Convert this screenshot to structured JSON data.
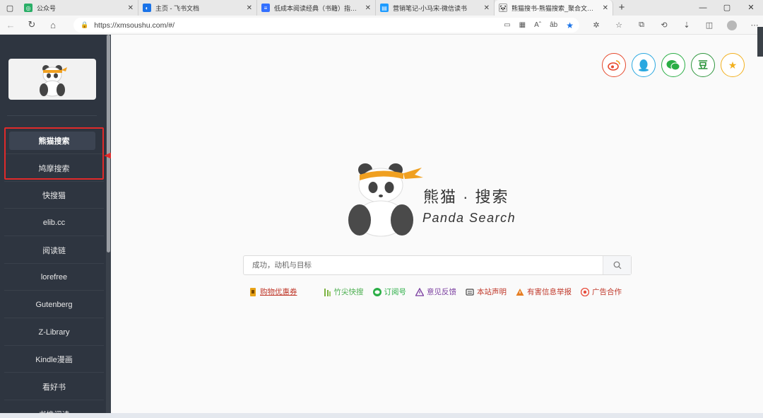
{
  "browser": {
    "tabs": [
      {
        "title": "公众号",
        "favicon_color": "#2aae67",
        "active": false
      },
      {
        "title": "主页 - 飞书文档",
        "favicon_color": "#1a73e8",
        "active": false
      },
      {
        "title": "低成本阅读经典（书籍）指南 | 飞",
        "favicon_color": "#3370ff",
        "active": false
      },
      {
        "title": "营销笔记-小马宋-微信读书",
        "favicon_color": "#1e9bff",
        "active": false
      },
      {
        "title": "熊猫搜书-熊猫搜索_聚合文档搜索",
        "favicon_color": "#333333",
        "active": true
      }
    ],
    "url": "https://xmsoushu.com/#/",
    "read_aloud_icon": "Aˆ",
    "translate_icon": "âb"
  },
  "sidebar": {
    "items": [
      {
        "label": "熊猫搜索",
        "active": true
      },
      {
        "label": "鸠摩搜索",
        "active": false
      },
      {
        "label": "快搜猫",
        "active": false
      },
      {
        "label": "elib.cc",
        "active": false
      },
      {
        "label": "阅读链",
        "active": false
      },
      {
        "label": "lorefree",
        "active": false
      },
      {
        "label": "Gutenberg",
        "active": false
      },
      {
        "label": "Z-Library",
        "active": false
      },
      {
        "label": "Kindle漫画",
        "active": false
      },
      {
        "label": "看好书",
        "active": false
      },
      {
        "label": "书推阅读",
        "active": false
      }
    ]
  },
  "social": [
    {
      "name": "weibo",
      "color": "#e6492d",
      "glyph": "微"
    },
    {
      "name": "qq",
      "color": "#2aa8e0",
      "glyph": "Q"
    },
    {
      "name": "wechat",
      "color": "#2aae45",
      "glyph": "✉"
    },
    {
      "name": "douban",
      "color": "#2e963d",
      "glyph": "豆"
    },
    {
      "name": "favorite",
      "color": "#f2b01e",
      "glyph": "★"
    }
  ],
  "brand": {
    "name_cn": "熊猫 · 搜索",
    "name_en": "Panda Search"
  },
  "search": {
    "placeholder": "成功，动机与目标"
  },
  "links": [
    {
      "label": "购物优惠券",
      "color": "#c0392b",
      "icon_color": "#e8a317",
      "icon": "▮"
    },
    {
      "label": "竹尖快搜",
      "color": "#4caf50",
      "icon_color": "#7cb342",
      "icon": "⫶"
    },
    {
      "label": "订阅号",
      "color": "#2aae45",
      "icon_color": "#2aae45",
      "icon": "●"
    },
    {
      "label": "意见反馈",
      "color": "#7b3fa0",
      "icon_color": "#7b3fa0",
      "icon": "△"
    },
    {
      "label": "本站声明",
      "color": "#c0392b",
      "icon_color": "#444444",
      "icon": "▭"
    },
    {
      "label": "有害信息举报",
      "color": "#c0392b",
      "icon_color": "#e67e22",
      "icon": "△"
    },
    {
      "label": "广告合作",
      "color": "#c0392b",
      "icon_color": "#e74c3c",
      "icon": "◉"
    }
  ]
}
